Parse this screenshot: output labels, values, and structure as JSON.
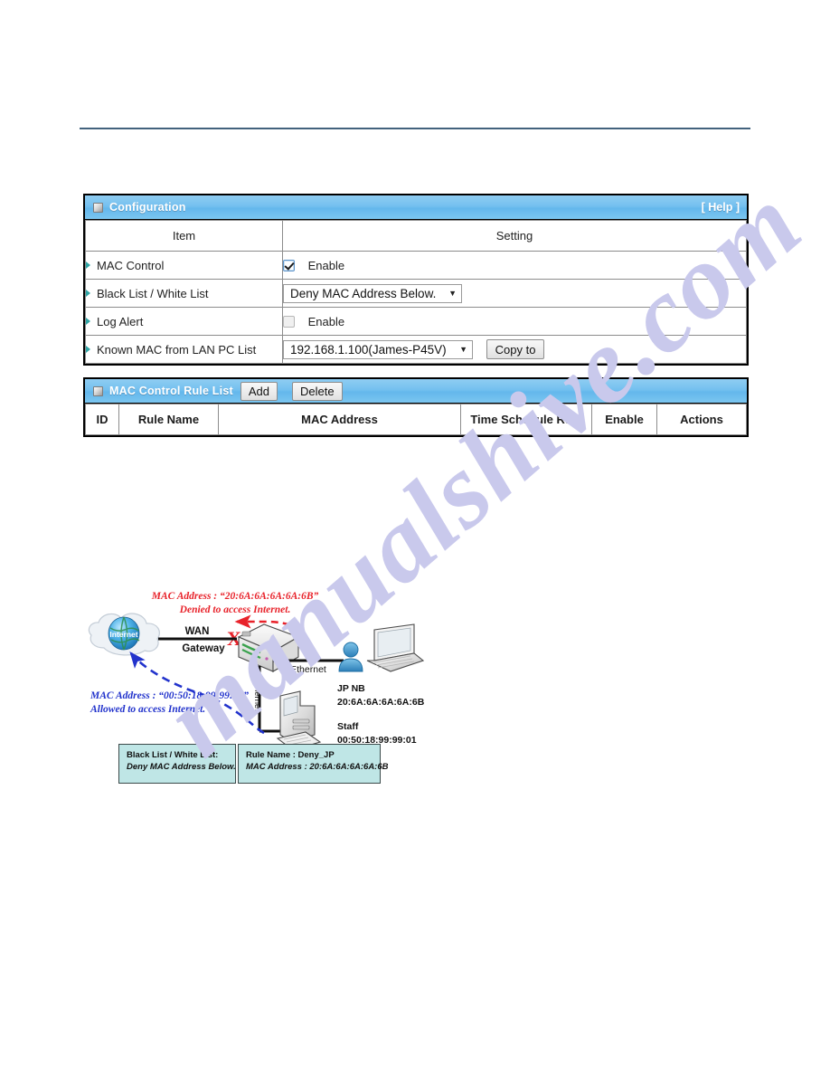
{
  "configuration": {
    "title": "Configuration",
    "help_label": "[ Help ]",
    "columns": {
      "item": "Item",
      "setting": "Setting"
    },
    "rows": [
      {
        "item": "MAC Control",
        "control": "checkbox",
        "label": "Enable",
        "checked": true
      },
      {
        "item": "Black List / White List",
        "control": "select",
        "value": "Deny MAC Address Below."
      },
      {
        "item": "Log Alert",
        "control": "checkbox",
        "label": "Enable",
        "checked": false
      },
      {
        "item": "Known MAC from LAN PC List",
        "control": "select",
        "value": "192.168.1.100(James-P45V)",
        "button": "Copy to"
      }
    ]
  },
  "rule_list": {
    "title": "MAC Control Rule List",
    "add_label": "Add",
    "delete_label": "Delete",
    "columns": [
      "ID",
      "Rule Name",
      "MAC Address",
      "Time Schedule Rule",
      "Enable",
      "Actions"
    ],
    "rows": []
  },
  "diagram": {
    "internet_label": "Internet",
    "wan_label": "WAN",
    "gateway_label": "Gateway",
    "ethernet_label_1": "Ethernet",
    "ethernet_label_2": "Ethernet",
    "deny_note_line1": "MAC Address : “20:6A:6A:6A:6A:6B”",
    "deny_note_line2": "Denied to access Internet.",
    "allow_note_line1": "MAC Address : “00:50:18:99:99:01”",
    "allow_note_line2": "Allowed to access Internet.",
    "cross_mark": "X",
    "nodes": [
      {
        "name": "JP NB",
        "mac": "20:6A:6A:6A:6A:6B"
      },
      {
        "name": "Staff",
        "mac": "00:50:18:99:99:01"
      }
    ]
  },
  "callouts": {
    "left": {
      "line1": "Black List / White List:",
      "line2": "Deny MAC Address Below."
    },
    "right": {
      "line1": "Rule Name : Deny_JP",
      "line2": "MAC Address : 20:6A:6A:6A:6A:6B"
    }
  },
  "watermark": {
    "text": "manualshive.com"
  },
  "colors": {
    "header_blue": "#74c0ef",
    "rule_teal": "#42627d",
    "bullet_teal": "#2fa6a6",
    "deny_red": "#e8222a",
    "allow_blue": "#2233cc",
    "callout_bg": "#bfe6e6",
    "watermark": "#c9c9ec"
  }
}
